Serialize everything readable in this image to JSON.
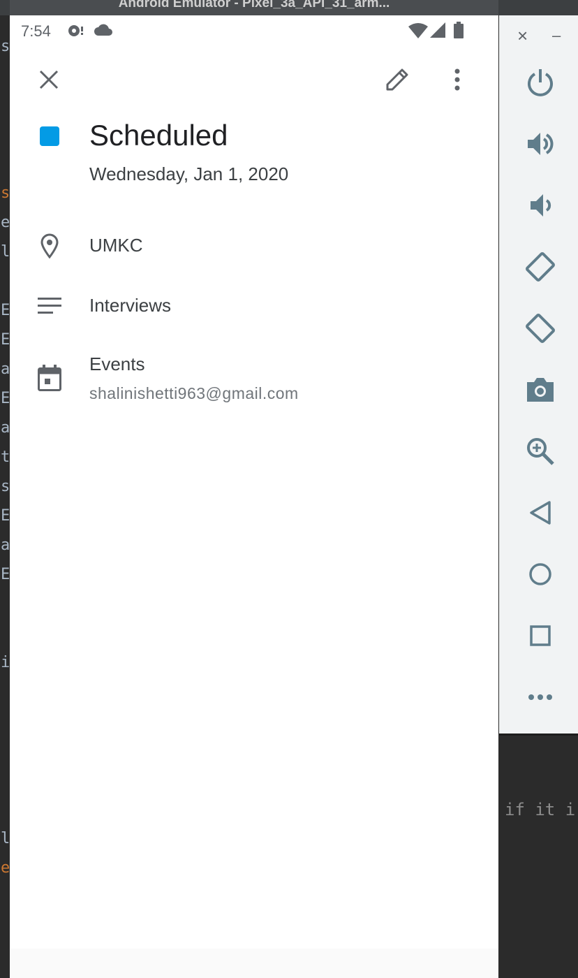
{
  "window": {
    "title": "Android Emulator - Pixel_3a_API_31_arm..."
  },
  "status_bar": {
    "time": "7:54"
  },
  "event": {
    "title": "Scheduled",
    "date": "Wednesday, Jan 1, 2020",
    "location": "UMKC",
    "description": "Interviews",
    "calendar_name": "Events",
    "calendar_account": "shalinishetti963@gmail.com",
    "color": "#039be5"
  },
  "ide": {
    "left_gutter_chars": [
      "s",
      "s",
      "e",
      "l",
      "E",
      "E",
      "a",
      "E",
      "a",
      "t",
      "s",
      "E",
      "a",
      "E",
      "i",
      "l",
      "e"
    ],
    "right_code": "if it i"
  },
  "emulator_panel": {
    "close_label": "×",
    "minimize_label": "–",
    "tools": [
      "power-icon",
      "volume-up-icon",
      "volume-down-icon",
      "rotate-left-icon",
      "rotate-right-icon",
      "camera-icon",
      "zoom-icon",
      "back-icon",
      "home-icon",
      "overview-icon",
      "more-icon"
    ]
  },
  "colors": {
    "icon": "#5f6368",
    "panel_icon": "#607d8b",
    "accent": "#039be5"
  }
}
